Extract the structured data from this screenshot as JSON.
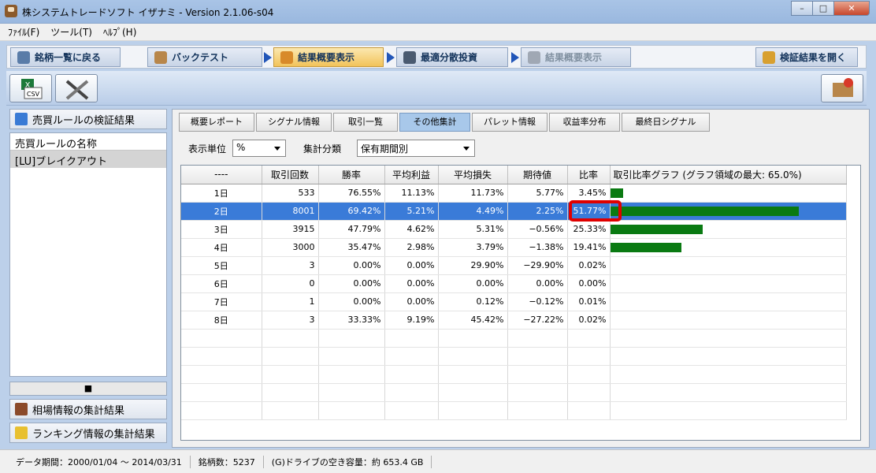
{
  "window": {
    "title": "株システムトレードソフト イザナミ - Version 2.1.06-s04"
  },
  "menu": [
    "ﾌｧｲﾙ(F)",
    "ツール(T)",
    "ﾍﾙﾌﾟ(H)"
  ],
  "nav": {
    "back": "銘柄一覧に戻る",
    "backtest": "バックテスト",
    "summary": "結果概要表示",
    "optimal": "最適分散投資",
    "summary2": "結果概要表示",
    "open": "検証結果を開く"
  },
  "left": {
    "header": "売買ルールの検証結果",
    "list_header": "売買ルールの名称",
    "rule": "[LU]ブレイクアウト",
    "market_btn": "相場情報の集計結果",
    "ranking_btn": "ランキング情報の集計結果"
  },
  "subtabs": [
    "概要レポート",
    "シグナル情報",
    "取引一覧",
    "その他集計",
    "パレット情報",
    "収益率分布",
    "最終日シグナル"
  ],
  "filters": {
    "unit_label": "表示単位",
    "unit_value": "%",
    "agg_label": "集計分類",
    "agg_value": "保有期間別"
  },
  "table": {
    "columns": [
      "----",
      "取引回数",
      "勝率",
      "平均利益",
      "平均損失",
      "期待値",
      "比率",
      "取引比率グラフ (グラフ領域の最大: 65.0%)"
    ],
    "rows": [
      [
        "1日",
        "533",
        "76.55%",
        "11.13%",
        "11.73%",
        "5.77%",
        "3.45%"
      ],
      [
        "2日",
        "8001",
        "69.42%",
        "5.21%",
        "4.49%",
        "2.25%",
        "51.77%"
      ],
      [
        "3日",
        "3915",
        "47.79%",
        "4.62%",
        "5.31%",
        "−0.56%",
        "25.33%"
      ],
      [
        "4日",
        "3000",
        "35.47%",
        "2.98%",
        "3.79%",
        "−1.38%",
        "19.41%"
      ],
      [
        "5日",
        "3",
        "0.00%",
        "0.00%",
        "29.90%",
        "−29.90%",
        "0.02%"
      ],
      [
        "6日",
        "0",
        "0.00%",
        "0.00%",
        "0.00%",
        "0.00%",
        "0.00%"
      ],
      [
        "7日",
        "1",
        "0.00%",
        "0.00%",
        "0.12%",
        "−0.12%",
        "0.01%"
      ],
      [
        "8日",
        "3",
        "33.33%",
        "9.19%",
        "45.42%",
        "−27.22%",
        "0.02%"
      ]
    ],
    "ratios": [
      3.45,
      51.77,
      25.33,
      19.41,
      0.02,
      0.0,
      0.01,
      0.02
    ],
    "graph_max": 65.0,
    "selected_row": 1
  },
  "status": {
    "period": "データ期間：2000/01/04 ～ 2014/03/31",
    "count": "銘柄数：5237",
    "disk": "(G)ドライブの空き容量：約 653.4 GB"
  },
  "colors": {
    "bar": "#0a7a12",
    "selection": "#3a7bd8",
    "highlight": "#e00000"
  }
}
